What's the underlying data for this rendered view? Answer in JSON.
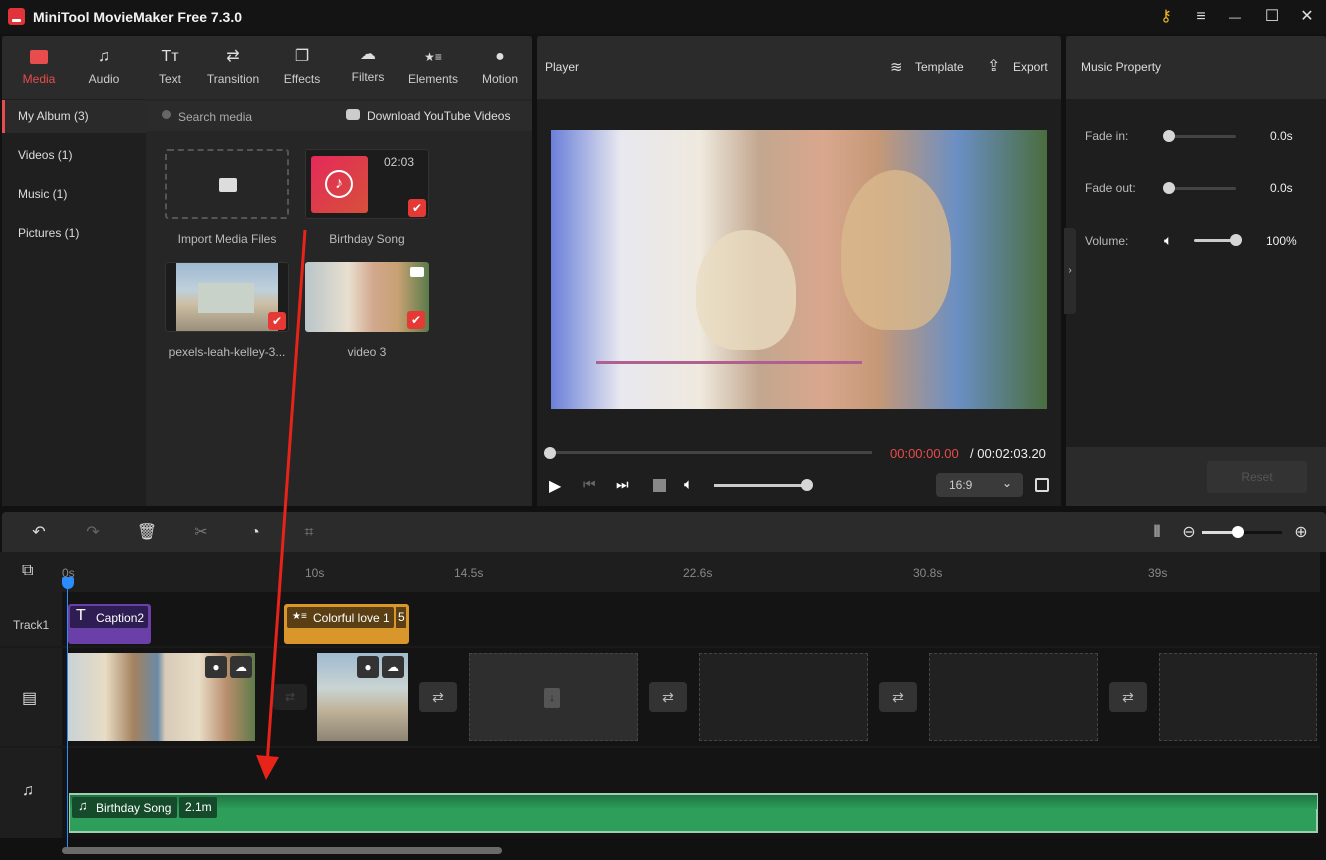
{
  "app": {
    "title": "MiniTool MovieMaker Free 7.3.0"
  },
  "window_controls": {
    "key": "key-icon",
    "menu": "≡",
    "minimize": "—",
    "maximize": "☐",
    "close": "✕"
  },
  "toolbar": {
    "tabs": [
      {
        "label": "Media",
        "icon": "folder-icon",
        "glyph": "▬",
        "active": true
      },
      {
        "label": "Audio",
        "icon": "music-icon",
        "glyph": "♫"
      },
      {
        "label": "Text",
        "icon": "text-icon",
        "glyph": "Tт"
      },
      {
        "label": "Transition",
        "icon": "transition-icon",
        "glyph": "⇄"
      },
      {
        "label": "Effects",
        "icon": "effects-icon",
        "glyph": "❐"
      },
      {
        "label": "Filters",
        "icon": "filters-icon",
        "glyph": "☁"
      },
      {
        "label": "Elements",
        "icon": "elements-icon",
        "glyph": "★≡"
      },
      {
        "label": "Motion",
        "icon": "motion-icon",
        "glyph": "●"
      }
    ]
  },
  "album_nav": [
    {
      "label": "My Album (3)",
      "active": true
    },
    {
      "label": "Videos (1)"
    },
    {
      "label": "Music (1)"
    },
    {
      "label": "Pictures (1)"
    }
  ],
  "media": {
    "search_placeholder": "Search media",
    "download_label": "Download YouTube Videos",
    "items": [
      {
        "label": "Import Media Files",
        "type": "import"
      },
      {
        "label": "Birthday Song",
        "type": "audio",
        "duration": "02:03",
        "checked": true
      },
      {
        "label": "pexels-leah-kelley-3...",
        "type": "image",
        "checked": true
      },
      {
        "label": "video 3",
        "type": "video",
        "checked": true
      }
    ]
  },
  "player": {
    "title": "Player",
    "template_label": "Template",
    "export_label": "Export",
    "current_time": "00:00:00.00",
    "total_time": "/ 00:02:03.20",
    "progress": 0,
    "volume": 1.0,
    "aspect_ratio": "16:9"
  },
  "property": {
    "title": "Music Property",
    "fade_in_label": "Fade in:",
    "fade_in_value": "0.0s",
    "fade_out_label": "Fade out:",
    "fade_out_value": "0.0s",
    "volume_label": "Volume:",
    "volume_value": "100%",
    "reset_label": "Reset"
  },
  "timeline": {
    "ruler_ticks": [
      "0s",
      "10s",
      "14.5s",
      "22.6s",
      "30.8s",
      "39s"
    ],
    "track1_label": "Track1",
    "caption_clip": "Caption2",
    "element_clip": "Colorful love 1",
    "element_clip_extra": "5",
    "audio_clip": "Birthday Song",
    "audio_duration": "2.1m",
    "zoom_level": 0.6
  },
  "colors": {
    "accent": "#e84c4c",
    "time_current": "#e84c4c",
    "audio_clip": "#2e9e5b",
    "caption_clip": "#6a3fa8",
    "element_clip": "#d9962a",
    "playhead": "#2a8cff"
  }
}
